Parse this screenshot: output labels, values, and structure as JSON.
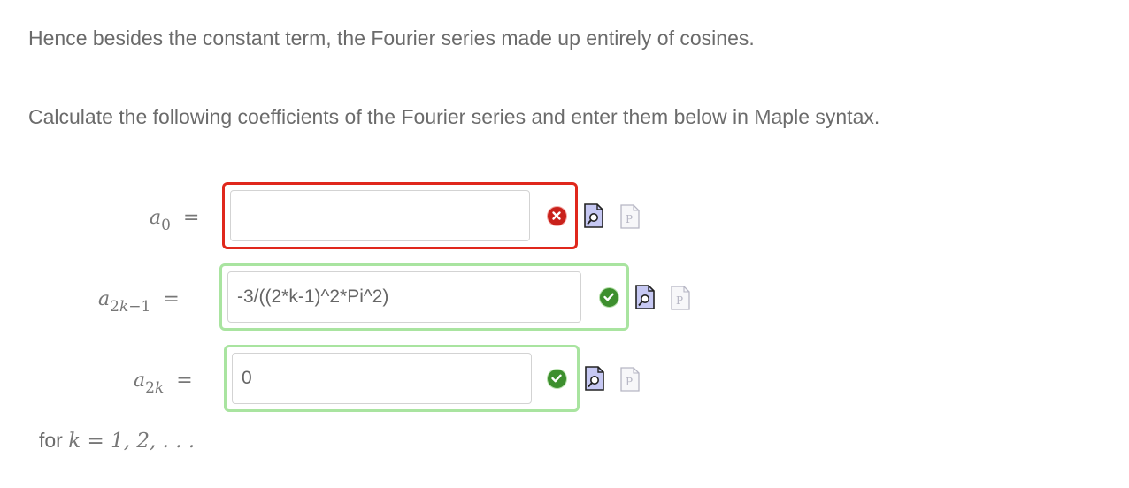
{
  "paragraphs": {
    "intro": "Hence besides the constant term, the Fourier series made up entirely of cosines.",
    "instruction": "Calculate the following coefficients of the Fourier series and enter them below in Maple syntax."
  },
  "rows": [
    {
      "var": "a",
      "sub": "0",
      "equals": "=",
      "value": "",
      "status": "incorrect",
      "status_color": "#c9211b"
    },
    {
      "var": "a",
      "sub_pre": "2",
      "sub_k": "k",
      "sub_post": "−1",
      "equals": "=",
      "value": "-3/((2*k-1)^2*Pi^2)",
      "status": "correct",
      "status_color": "#3d8f2e"
    },
    {
      "var": "a",
      "sub_pre": "2",
      "sub_k": "k",
      "sub_post": "",
      "equals": "=",
      "value": "0",
      "status": "correct",
      "status_color": "#3d8f2e"
    }
  ],
  "footer": {
    "for": "for ",
    "var": "k",
    "rest": " = 1, 2, . . ."
  },
  "icons": {
    "preview": "preview-magnifier-icon",
    "maple": "maple-p-icon",
    "incorrect": "x-circle-icon",
    "correct": "check-circle-icon"
  },
  "colors": {
    "error_border": "#e0281c",
    "success_border": "#a9e4a0",
    "text": "#6b6b6b"
  }
}
